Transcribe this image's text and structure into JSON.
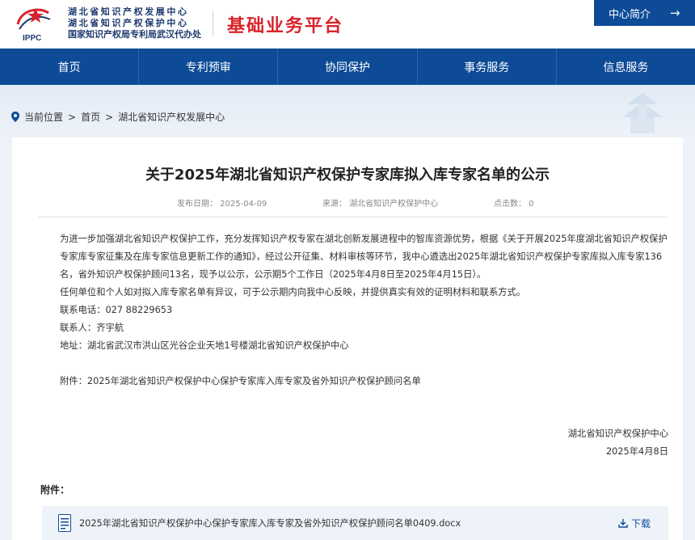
{
  "header": {
    "logo_text": "IPPC",
    "org_lines": [
      "湖北省知识产权发展中心",
      "湖北省知识产权保护中心",
      "国家知识产权局专利局武汉代办处"
    ],
    "platform_title": "基础业务平台",
    "center_button": "中心简介",
    "arrow": "→"
  },
  "nav": {
    "items": [
      "首页",
      "专利预审",
      "协同保护",
      "事务服务",
      "信息服务"
    ]
  },
  "breadcrumb": {
    "items": [
      "当前位置",
      "首页",
      "湖北省知识产权发展中心"
    ],
    "separator": ">"
  },
  "article": {
    "title": "关于2025年湖北省知识产权保护专家库拟入库专家名单的公示",
    "meta": {
      "date": "发布日期： 2025-04-09",
      "source": "来源： 湖北省知识产权保护中心",
      "views": "点击数： 0"
    },
    "paragraphs": [
      "为进一步加强湖北省知识产权保护工作，充分发挥知识产权专家在湖北创新发展进程中的智库资源优势，根据《关于开展2025年度湖北省知识产权保护专家库专家征集及在库专家信息更新工作的通知》，经过公开征集、材料审核等环节，我中心遴选出2025年湖北省知识产权保护专家库拟入库专家136名，省外知识产权保护顾问13名，现予以公示，公示期5个工作日（2025年4月8日至2025年4月15日）。",
      "任何单位和个人如对拟入库专家名单有异议，可于公示期内向我中心反映，并提供真实有效的证明材料和联系方式。",
      "联系电话：027 88229653",
      "联系人：齐宇航",
      "地址：湖北省武汉市洪山区光谷企业天地1号楼湖北省知识产权保护中心",
      "附件：2025年湖北省知识产权保护中心保护专家库入库专家及省外知识产权保护顾问名单"
    ],
    "signature_org": "湖北省知识产权保护中心",
    "signature_date": "2025年4月8日"
  },
  "attachments": {
    "label": "附件：",
    "files": [
      {
        "name": "2025年湖北省知识产权保护中心保护专家库入库专家及省外知识产权保护顾问名单0409.docx",
        "action": "下载"
      }
    ]
  },
  "colors": {
    "brand_blue": "#0d4b97",
    "title_red": "#d9232a",
    "card_bg": "#ffffff",
    "page_bg": "#eef3f9"
  }
}
